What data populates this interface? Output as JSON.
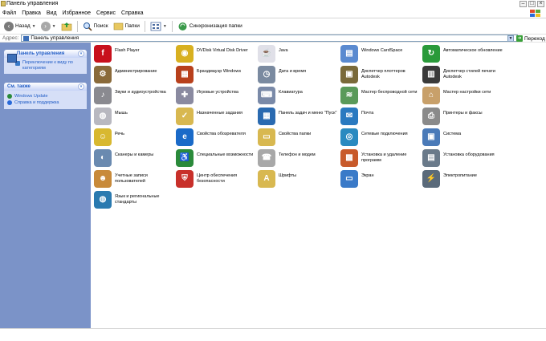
{
  "window": {
    "title": "Панель управления"
  },
  "menu": [
    "Файл",
    "Правка",
    "Вид",
    "Избранное",
    "Сервис",
    "Справка"
  ],
  "toolbar": {
    "back_label": "Назад",
    "search_label": "Поиск",
    "folders_label": "Папки",
    "sync_label": "Синхронизация папки"
  },
  "address": {
    "label": "Адрес:",
    "value": "Панель управления",
    "go_label": "Переход"
  },
  "sidebar": {
    "panel1": {
      "title": "Панель управления",
      "link": "Переключение к виду по категориям"
    },
    "panel2": {
      "title": "См. также",
      "items": [
        "Windows Update",
        "Справка и поддержка"
      ]
    }
  },
  "items": [
    {
      "label": "Flash Player",
      "icon": "flash-player-icon",
      "color": "#c8101c",
      "glyph": "f"
    },
    {
      "label": "DVDisk Virtual Disk Driver",
      "icon": "disk-driver-icon",
      "color": "#d8b020",
      "glyph": "◉"
    },
    {
      "label": "Java",
      "icon": "java-icon",
      "color": "#e0e0e8",
      "glyph": "☕"
    },
    {
      "label": "Windows CardSpace",
      "icon": "cardspace-icon",
      "color": "#5a8ad0",
      "glyph": "▤"
    },
    {
      "label": "Автоматическое обновление",
      "icon": "auto-update-icon",
      "color": "#2a9a3a",
      "glyph": "↻"
    },
    {
      "label": "Администрирование",
      "icon": "admin-tools-icon",
      "color": "#8a6a3a",
      "glyph": "⚙"
    },
    {
      "label": "Брандмауэр Windows",
      "icon": "firewall-icon",
      "color": "#b8401c",
      "glyph": "▦"
    },
    {
      "label": "Дата и время",
      "icon": "clock-icon",
      "color": "#7a8aa0",
      "glyph": "◷"
    },
    {
      "label": "Диспетчер плоттеров Autodesk",
      "icon": "plotter-icon",
      "color": "#7a6a3a",
      "glyph": "▣"
    },
    {
      "label": "Диспетчер стилей печати Autodesk",
      "icon": "print-styles-icon",
      "color": "#3a3a3a",
      "glyph": "▥"
    },
    {
      "label": "Звуки и аудиоустройства",
      "icon": "speaker-icon",
      "color": "#8a8a90",
      "glyph": "♪"
    },
    {
      "label": "Игровые устройства",
      "icon": "gamepad-icon",
      "color": "#8a8aa0",
      "glyph": "✚"
    },
    {
      "label": "Клавиатура",
      "icon": "keyboard-icon",
      "color": "#7a8aa8",
      "glyph": "⌨"
    },
    {
      "label": "Мастер беспроводной сети",
      "icon": "wireless-icon",
      "color": "#5a9a5a",
      "glyph": "≋"
    },
    {
      "label": "Мастер настройки сети",
      "icon": "network-setup-icon",
      "color": "#c8a06a",
      "glyph": "⌂"
    },
    {
      "label": "Мышь",
      "icon": "mouse-icon",
      "color": "#b8b8c0",
      "glyph": "◍"
    },
    {
      "label": "Назначенные задания",
      "icon": "scheduled-tasks-icon",
      "color": "#d8b850",
      "glyph": "✓"
    },
    {
      "label": "Панель задач и меню \"Пуск\"",
      "icon": "taskbar-icon",
      "color": "#2a6ab0",
      "glyph": "▦"
    },
    {
      "label": "Почта",
      "icon": "mail-icon",
      "color": "#2a7ac0",
      "glyph": "✉"
    },
    {
      "label": "Принтеры и факсы",
      "icon": "printer-icon",
      "color": "#8a8a8a",
      "glyph": "⎙"
    },
    {
      "label": "Речь",
      "icon": "speech-icon",
      "color": "#d8b830",
      "glyph": "☺"
    },
    {
      "label": "Свойства обозревателя",
      "icon": "internet-options-icon",
      "color": "#1a6ac8",
      "glyph": "e"
    },
    {
      "label": "Свойства папки",
      "icon": "folder-options-icon",
      "color": "#d8b850",
      "glyph": "▭"
    },
    {
      "label": "Сетевые подключения",
      "icon": "network-connections-icon",
      "color": "#2a8ac0",
      "glyph": "◎"
    },
    {
      "label": "Система",
      "icon": "system-icon",
      "color": "#4a7ab8",
      "glyph": "▣"
    },
    {
      "label": "Сканеры и камеры",
      "icon": "scanner-icon",
      "color": "#6a8ab0",
      "glyph": "◐"
    },
    {
      "label": "Специальные возможности",
      "icon": "accessibility-icon",
      "color": "#2a8a3a",
      "glyph": "♿"
    },
    {
      "label": "Телефон и модем",
      "icon": "phone-icon",
      "color": "#a8a8a8",
      "glyph": "☎"
    },
    {
      "label": "Установка и удаление программ",
      "icon": "add-remove-icon",
      "color": "#c85a2a",
      "glyph": "▩"
    },
    {
      "label": "Установка оборудования",
      "icon": "hardware-icon",
      "color": "#6a7a8a",
      "glyph": "▤"
    },
    {
      "label": "Учетные записи пользователей",
      "icon": "user-accounts-icon",
      "color": "#c88a3a",
      "glyph": "☻"
    },
    {
      "label": "Центр обеспечения безопасности",
      "icon": "security-center-icon",
      "color": "#c8302a",
      "glyph": "⛨"
    },
    {
      "label": "Шрифты",
      "icon": "fonts-icon",
      "color": "#d8b850",
      "glyph": "A"
    },
    {
      "label": "Экран",
      "icon": "display-icon",
      "color": "#3a7ac8",
      "glyph": "▭"
    },
    {
      "label": "Электропитание",
      "icon": "power-icon",
      "color": "#5a6a7a",
      "glyph": "⚡"
    },
    {
      "label": "Язык и региональные стандарты",
      "icon": "regional-icon",
      "color": "#2a7ab0",
      "glyph": "◍"
    }
  ],
  "colors": {
    "sidebar_bg": "#7b93c8",
    "panel_bg": "#d6dff7",
    "link": "#215dc6"
  }
}
